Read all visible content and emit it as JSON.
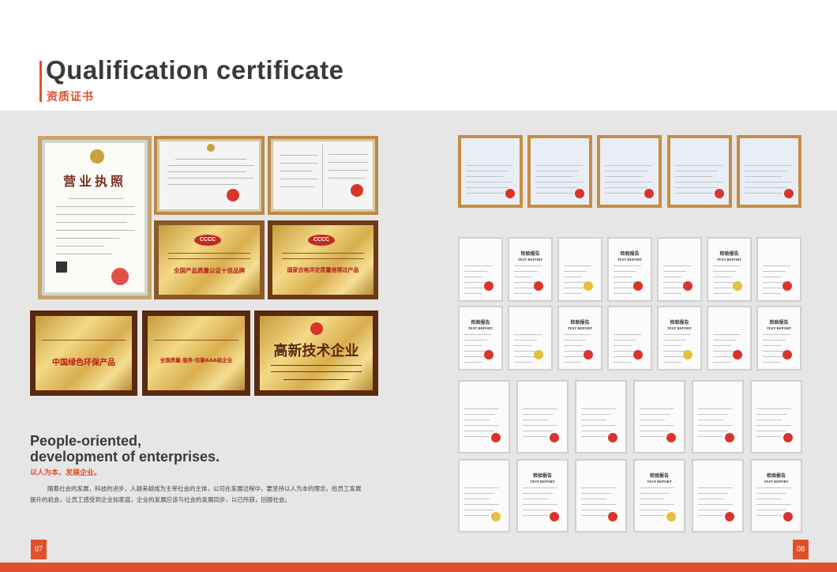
{
  "header": {
    "title_en": "Qualification certificate",
    "title_cn": "资质证书"
  },
  "left": {
    "license": {
      "title": "营业执照"
    },
    "plaques": {
      "gold1": {
        "line1": "全国产品质量公证十佳品牌"
      },
      "gold2": {
        "line1": "国家合格评定质量信得过产品"
      },
      "wood1": {
        "line1": "中国绿色环保产品"
      },
      "wood2": {
        "line1": "全国质量·服务·信誉AAA级企业"
      },
      "hightech": {
        "line1": "高新技术企业"
      }
    },
    "slogan_en_line1": "People-oriented,",
    "slogan_en_line2": "development of enterprises.",
    "slogan_cn": "以人为本，发展企业。",
    "body": "随着社会的发展，科技的进步，人越来越成为主宰社会的主体，公司在发展过程中，要坚持以人为本的理念，给员工发展提升的机会，让员工感受到企业如家庭，企业的发展应该与社会的发展同步，以已所获，回报社会。"
  },
  "right": {
    "test_report_cn": "检验报告",
    "test_report_en": "TEST REPORT"
  },
  "pages": {
    "left": "07",
    "right": "08"
  },
  "colors": {
    "accent": "#e0502a",
    "panel": "#e6e6e6",
    "frame": "#c58d43"
  }
}
